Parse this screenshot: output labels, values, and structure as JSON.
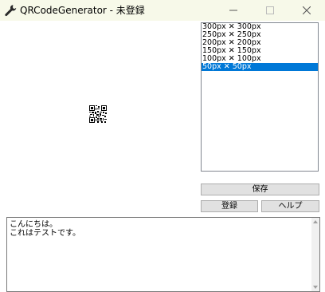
{
  "window": {
    "title": "QRCodeGenerator - 未登録",
    "icon": "wrench-icon"
  },
  "size_list": {
    "items": [
      "300px ✕ 300px",
      "250px ✕ 250px",
      "200px ✕ 200px",
      "150px ✕ 150px",
      "100px ✕ 100px",
      "50px ✕ 50px"
    ],
    "selected_index": 5
  },
  "buttons": {
    "save": "保存",
    "register": "登録",
    "help": "ヘルプ"
  },
  "text_input": {
    "lines": [
      "こんにちは。",
      "これはテストです。"
    ]
  },
  "colors": {
    "titlebar": "#f7f9e9",
    "selection": "#0078d7",
    "button_face": "#e1e1e1"
  }
}
